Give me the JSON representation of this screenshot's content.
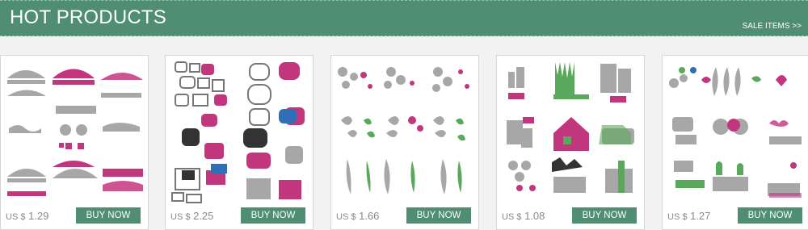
{
  "header": {
    "title": "HOT PRODUCTS",
    "sale_link": "SALE ITEMS >>"
  },
  "colors": {
    "accent": "#4f8e73",
    "pink": "#c2367e",
    "gray": "#a7a7a7",
    "green": "#5aa85c",
    "blue": "#2f6fb5"
  },
  "products": [
    {
      "currency": "US $",
      "price": "1.29",
      "button": "BUY NOW",
      "image_icon": "lace-border-dies-image"
    },
    {
      "currency": "US $",
      "price": "2.25",
      "button": "BUY NOW",
      "image_icon": "frame-dies-image"
    },
    {
      "currency": "US $",
      "price": "1.66",
      "button": "BUY NOW",
      "image_icon": "flower-leaf-dies-image"
    },
    {
      "currency": "US $",
      "price": "1.08",
      "button": "BUY NOW",
      "image_icon": "house-car-dies-image"
    },
    {
      "currency": "US $",
      "price": "1.27",
      "button": "BUY NOW",
      "image_icon": "bird-cactus-dies-image"
    }
  ]
}
